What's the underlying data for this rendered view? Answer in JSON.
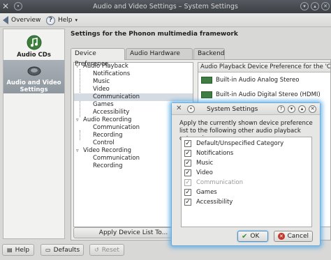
{
  "window": {
    "title": "Audio and Video Settings – System Settings"
  },
  "toolbar": {
    "overview_label": "Overview",
    "help_label": "Help"
  },
  "sidebar": {
    "items": [
      {
        "label": "Audio CDs",
        "icon": "music-note-icon"
      },
      {
        "label": "Audio and Video Settings",
        "icon": "speaker-icon"
      }
    ]
  },
  "main": {
    "heading": "Settings for the Phonon multimedia framework",
    "tabs": [
      "Device Preference",
      "Audio Hardware Setup",
      "Backend"
    ],
    "tree": [
      {
        "label": "Audio Playback",
        "level": 0,
        "expanded": true
      },
      {
        "label": "Notifications",
        "level": 1
      },
      {
        "label": "Music",
        "level": 1
      },
      {
        "label": "Video",
        "level": 1
      },
      {
        "label": "Communication",
        "level": 1,
        "selected": true
      },
      {
        "label": "Games",
        "level": 1
      },
      {
        "label": "Accessibility",
        "level": 1
      },
      {
        "label": "Audio Recording",
        "level": 0,
        "expanded": true
      },
      {
        "label": "Communication",
        "level": 1
      },
      {
        "label": "Recording",
        "level": 1
      },
      {
        "label": "Control",
        "level": 1
      },
      {
        "label": "Video Recording",
        "level": 0,
        "expanded": true
      },
      {
        "label": "Communication",
        "level": 1
      },
      {
        "label": "Recording",
        "level": 1
      }
    ],
    "apply_button": "Apply Device List To...",
    "pref_header": "Audio Playback Device Preference for the 'Com",
    "devices": [
      "Built-in Audio Analog Stereo",
      "Built-in Audio Digital Stereo (HDMI)"
    ]
  },
  "bottom": {
    "help": "Help",
    "defaults": "Defaults",
    "reset": "Reset"
  },
  "dialog": {
    "title": "System Settings",
    "message": "Apply the currently shown device preference list to the following other audio playback categories:",
    "categories": [
      {
        "label": "Default/Unspecified Category",
        "checked": true,
        "enabled": true
      },
      {
        "label": "Notifications",
        "checked": true,
        "enabled": true
      },
      {
        "label": "Music",
        "checked": true,
        "enabled": true
      },
      {
        "label": "Video",
        "checked": true,
        "enabled": true
      },
      {
        "label": "Communication",
        "checked": true,
        "enabled": false
      },
      {
        "label": "Games",
        "checked": true,
        "enabled": true
      },
      {
        "label": "Accessibility",
        "checked": true,
        "enabled": true
      }
    ],
    "ok": "OK",
    "cancel": "Cancel"
  },
  "colors": {
    "titlebar": "#464b50",
    "dialog_glow": "#56aae6",
    "selection": "#d5dbe2"
  }
}
